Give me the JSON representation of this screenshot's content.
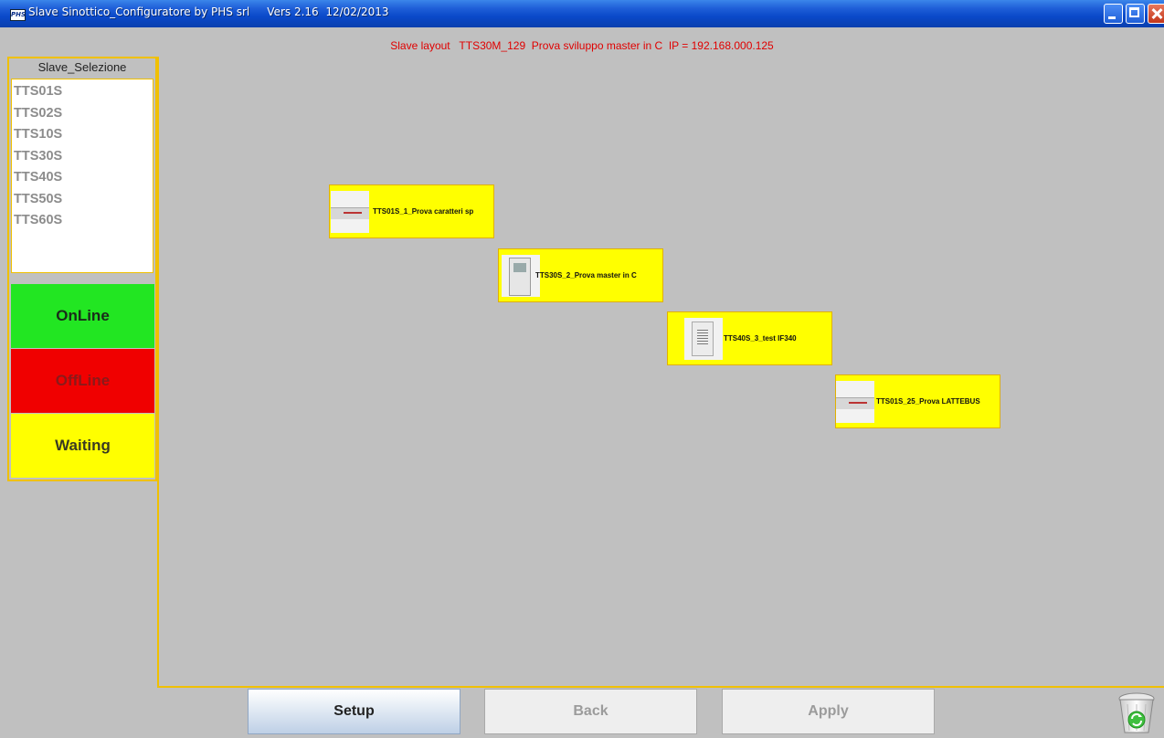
{
  "window": {
    "title": "Slave Sinottico_Configuratore by PHS srl     Vers 2.16  12/02/2013",
    "app_icon_text": "PHS"
  },
  "header": {
    "layout_text": "Slave layout   TTS30M_129  Prova sviluppo master in C  IP = 192.168.000.125"
  },
  "sidebar": {
    "caption": "Slave_Selezione",
    "items": [
      "TTS01S",
      "TTS02S",
      "TTS10S",
      "TTS30S",
      "TTS40S",
      "TTS50S",
      "TTS60S"
    ]
  },
  "status_legend": {
    "online": "OnLine",
    "offline": "OffLine",
    "waiting": "Waiting",
    "colors": {
      "online": "#22e622",
      "offline": "#f00000",
      "waiting": "#ffff00"
    }
  },
  "devices": [
    {
      "label": "TTS01S_1_Prova caratteri sp",
      "icon": "slave-device-panel-icon"
    },
    {
      "label": "TTS30S_2_Prova master in C",
      "icon": "slave-device-terminal-icon"
    },
    {
      "label": "TTS40S_3_test IF340",
      "icon": "slave-device-module-icon"
    },
    {
      "label": "TTS01S_25_Prova LATTEBUS",
      "icon": "slave-device-panel-icon"
    }
  ],
  "buttons": {
    "setup": "Setup",
    "back": "Back",
    "apply": "Apply"
  },
  "icons": {
    "recycle_bin": "recycle-bin-icon"
  }
}
